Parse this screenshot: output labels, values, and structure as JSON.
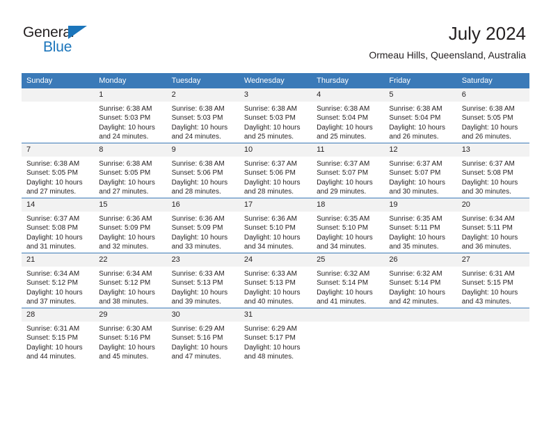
{
  "brand": {
    "name_part1": "General",
    "name_part2": "Blue",
    "accent_color": "#1b75bb"
  },
  "header": {
    "title": "July 2024",
    "subtitle": "Ormeau Hills, Queensland, Australia"
  },
  "calendar": {
    "header_bg": "#3b7ab8",
    "daynum_bg": "#f2f2f2",
    "weekdays": [
      "Sunday",
      "Monday",
      "Tuesday",
      "Wednesday",
      "Thursday",
      "Friday",
      "Saturday"
    ],
    "weeks": [
      [
        {
          "day": "",
          "lines": []
        },
        {
          "day": "1",
          "lines": [
            "Sunrise: 6:38 AM",
            "Sunset: 5:03 PM",
            "Daylight: 10 hours",
            "and 24 minutes."
          ]
        },
        {
          "day": "2",
          "lines": [
            "Sunrise: 6:38 AM",
            "Sunset: 5:03 PM",
            "Daylight: 10 hours",
            "and 24 minutes."
          ]
        },
        {
          "day": "3",
          "lines": [
            "Sunrise: 6:38 AM",
            "Sunset: 5:03 PM",
            "Daylight: 10 hours",
            "and 25 minutes."
          ]
        },
        {
          "day": "4",
          "lines": [
            "Sunrise: 6:38 AM",
            "Sunset: 5:04 PM",
            "Daylight: 10 hours",
            "and 25 minutes."
          ]
        },
        {
          "day": "5",
          "lines": [
            "Sunrise: 6:38 AM",
            "Sunset: 5:04 PM",
            "Daylight: 10 hours",
            "and 26 minutes."
          ]
        },
        {
          "day": "6",
          "lines": [
            "Sunrise: 6:38 AM",
            "Sunset: 5:05 PM",
            "Daylight: 10 hours",
            "and 26 minutes."
          ]
        }
      ],
      [
        {
          "day": "7",
          "lines": [
            "Sunrise: 6:38 AM",
            "Sunset: 5:05 PM",
            "Daylight: 10 hours",
            "and 27 minutes."
          ]
        },
        {
          "day": "8",
          "lines": [
            "Sunrise: 6:38 AM",
            "Sunset: 5:05 PM",
            "Daylight: 10 hours",
            "and 27 minutes."
          ]
        },
        {
          "day": "9",
          "lines": [
            "Sunrise: 6:38 AM",
            "Sunset: 5:06 PM",
            "Daylight: 10 hours",
            "and 28 minutes."
          ]
        },
        {
          "day": "10",
          "lines": [
            "Sunrise: 6:37 AM",
            "Sunset: 5:06 PM",
            "Daylight: 10 hours",
            "and 28 minutes."
          ]
        },
        {
          "day": "11",
          "lines": [
            "Sunrise: 6:37 AM",
            "Sunset: 5:07 PM",
            "Daylight: 10 hours",
            "and 29 minutes."
          ]
        },
        {
          "day": "12",
          "lines": [
            "Sunrise: 6:37 AM",
            "Sunset: 5:07 PM",
            "Daylight: 10 hours",
            "and 30 minutes."
          ]
        },
        {
          "day": "13",
          "lines": [
            "Sunrise: 6:37 AM",
            "Sunset: 5:08 PM",
            "Daylight: 10 hours",
            "and 30 minutes."
          ]
        }
      ],
      [
        {
          "day": "14",
          "lines": [
            "Sunrise: 6:37 AM",
            "Sunset: 5:08 PM",
            "Daylight: 10 hours",
            "and 31 minutes."
          ]
        },
        {
          "day": "15",
          "lines": [
            "Sunrise: 6:36 AM",
            "Sunset: 5:09 PM",
            "Daylight: 10 hours",
            "and 32 minutes."
          ]
        },
        {
          "day": "16",
          "lines": [
            "Sunrise: 6:36 AM",
            "Sunset: 5:09 PM",
            "Daylight: 10 hours",
            "and 33 minutes."
          ]
        },
        {
          "day": "17",
          "lines": [
            "Sunrise: 6:36 AM",
            "Sunset: 5:10 PM",
            "Daylight: 10 hours",
            "and 34 minutes."
          ]
        },
        {
          "day": "18",
          "lines": [
            "Sunrise: 6:35 AM",
            "Sunset: 5:10 PM",
            "Daylight: 10 hours",
            "and 34 minutes."
          ]
        },
        {
          "day": "19",
          "lines": [
            "Sunrise: 6:35 AM",
            "Sunset: 5:11 PM",
            "Daylight: 10 hours",
            "and 35 minutes."
          ]
        },
        {
          "day": "20",
          "lines": [
            "Sunrise: 6:34 AM",
            "Sunset: 5:11 PM",
            "Daylight: 10 hours",
            "and 36 minutes."
          ]
        }
      ],
      [
        {
          "day": "21",
          "lines": [
            "Sunrise: 6:34 AM",
            "Sunset: 5:12 PM",
            "Daylight: 10 hours",
            "and 37 minutes."
          ]
        },
        {
          "day": "22",
          "lines": [
            "Sunrise: 6:34 AM",
            "Sunset: 5:12 PM",
            "Daylight: 10 hours",
            "and 38 minutes."
          ]
        },
        {
          "day": "23",
          "lines": [
            "Sunrise: 6:33 AM",
            "Sunset: 5:13 PM",
            "Daylight: 10 hours",
            "and 39 minutes."
          ]
        },
        {
          "day": "24",
          "lines": [
            "Sunrise: 6:33 AM",
            "Sunset: 5:13 PM",
            "Daylight: 10 hours",
            "and 40 minutes."
          ]
        },
        {
          "day": "25",
          "lines": [
            "Sunrise: 6:32 AM",
            "Sunset: 5:14 PM",
            "Daylight: 10 hours",
            "and 41 minutes."
          ]
        },
        {
          "day": "26",
          "lines": [
            "Sunrise: 6:32 AM",
            "Sunset: 5:14 PM",
            "Daylight: 10 hours",
            "and 42 minutes."
          ]
        },
        {
          "day": "27",
          "lines": [
            "Sunrise: 6:31 AM",
            "Sunset: 5:15 PM",
            "Daylight: 10 hours",
            "and 43 minutes."
          ]
        }
      ],
      [
        {
          "day": "28",
          "lines": [
            "Sunrise: 6:31 AM",
            "Sunset: 5:15 PM",
            "Daylight: 10 hours",
            "and 44 minutes."
          ]
        },
        {
          "day": "29",
          "lines": [
            "Sunrise: 6:30 AM",
            "Sunset: 5:16 PM",
            "Daylight: 10 hours",
            "and 45 minutes."
          ]
        },
        {
          "day": "30",
          "lines": [
            "Sunrise: 6:29 AM",
            "Sunset: 5:16 PM",
            "Daylight: 10 hours",
            "and 47 minutes."
          ]
        },
        {
          "day": "31",
          "lines": [
            "Sunrise: 6:29 AM",
            "Sunset: 5:17 PM",
            "Daylight: 10 hours",
            "and 48 minutes."
          ]
        },
        {
          "day": "",
          "lines": []
        },
        {
          "day": "",
          "lines": []
        },
        {
          "day": "",
          "lines": []
        }
      ]
    ]
  }
}
